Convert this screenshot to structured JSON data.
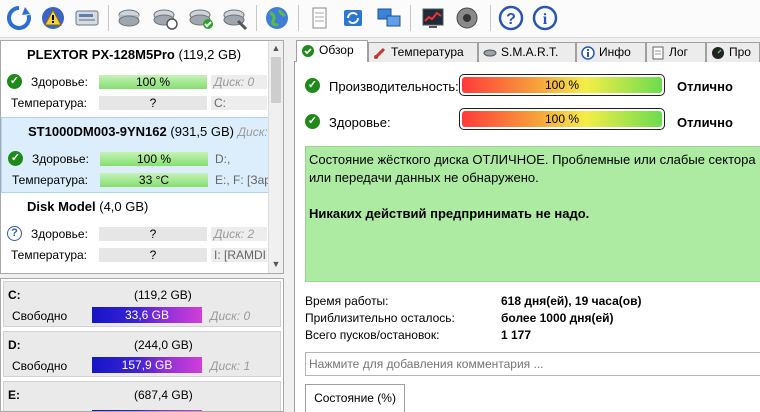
{
  "toolbar": {
    "icons": [
      "refresh-icon",
      "warning-icon",
      "drive-icon",
      "disk-icon",
      "disk-refresh-icon",
      "disk-check-icon",
      "disk-tools-icon",
      "globe-icon",
      "document-icon",
      "sync-icon",
      "network-icon",
      "chart-icon",
      "speaker-icon",
      "help-icon",
      "info-icon"
    ]
  },
  "disks": [
    {
      "name": "PLEXTOR PX-128M5Pro",
      "size": "(119,2 GB)",
      "health_label": "Здоровье:",
      "health_value": "100 %",
      "health_disk": "Диск: 0",
      "temp_label": "Температура:",
      "temp_value": "?",
      "temp_vol": "C:",
      "status": "good"
    },
    {
      "name": "ST1000DM003-9YN162",
      "size": "(931,5 GB)",
      "health_label": "Здоровье:",
      "health_value": "100 %",
      "health_disk": "D:,",
      "temp_label": "Температура:",
      "temp_value": "33 °C",
      "temp_vol": "E:, F: [Зар",
      "extra": "Диск:",
      "status": "good"
    },
    {
      "name": "Disk Model",
      "size": "(4,0 GB)",
      "health_label": "Здоровье:",
      "health_value": "?",
      "health_disk": "Диск: 2",
      "temp_label": "Температура:",
      "temp_value": "?",
      "temp_vol": "I: [RAMDI",
      "status": "unknown"
    }
  ],
  "volumes": [
    {
      "letter": "C:",
      "size": "(119,2 GB)",
      "free_label": "Свободно",
      "free_value": "33,6 GB",
      "disk": "Диск: 0"
    },
    {
      "letter": "D:",
      "size": "(244,0 GB)",
      "free_label": "Свободно",
      "free_value": "157,9 GB",
      "disk": "Диск: 1"
    },
    {
      "letter": "E:",
      "size": "(687,4 GB)",
      "free_label": "",
      "free_value": "",
      "disk": ""
    }
  ],
  "tabs": [
    {
      "label": "Обзор",
      "icon": "overview-icon",
      "active": true
    },
    {
      "label": "Температура",
      "icon": "thermometer-icon"
    },
    {
      "label": "S.M.A.R.T.",
      "icon": "smart-icon"
    },
    {
      "label": "Инфо",
      "icon": "info-icon"
    },
    {
      "label": "Лог",
      "icon": "log-icon"
    },
    {
      "label": "Про",
      "icon": "gauge-icon"
    }
  ],
  "overview": {
    "performance_label": "Производительность:",
    "performance_value": "100 %",
    "performance_rating": "Отлично",
    "health_label": "Здоровье:",
    "health_value": "100 %",
    "health_rating": "Отлично",
    "status_line1": "Состояние жёсткого диска ОТЛИЧНОЕ. Проблемные или слабые сектора",
    "status_line2": "или передачи данных не обнаружено.",
    "status_action": "Никаких действий предпринимать не надо.",
    "uptime_label": "Время работы:",
    "uptime_value": "618 дня(ей), 19 часа(ов)",
    "remaining_label": "Приблизительно осталось:",
    "remaining_value": "более 1000 дня(ей)",
    "starts_label": "Всего пусков/остановок:",
    "starts_value": "1 177",
    "comment_placeholder": "Нажмите для добавления комментария ...",
    "bottom_tab": "Состояние (%)"
  },
  "colors": {
    "good": "#1f8a1a",
    "unknown": "#2f5aa8",
    "status_bg": "#adeba3"
  }
}
